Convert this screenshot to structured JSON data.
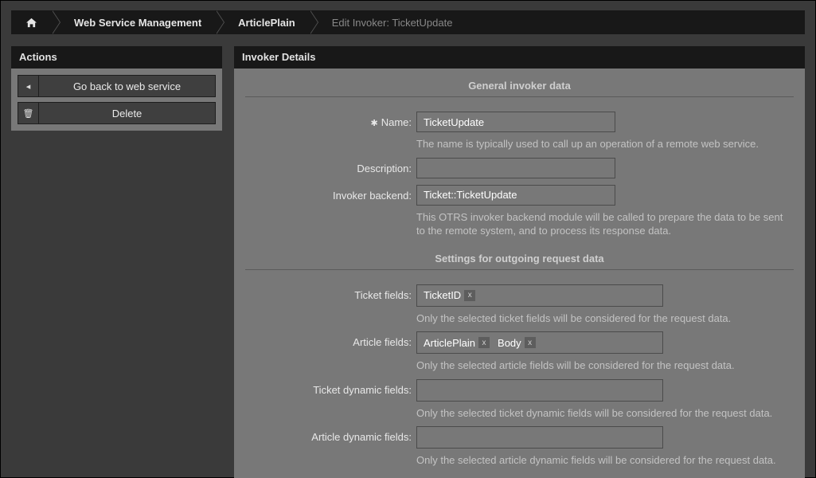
{
  "breadcrumb": {
    "items": [
      {
        "name": "home",
        "label": ""
      },
      {
        "name": "wsm",
        "label": "Web Service Management"
      },
      {
        "name": "ws",
        "label": "ArticlePlain"
      },
      {
        "name": "page",
        "label": "Edit Invoker: TicketUpdate"
      }
    ]
  },
  "sidebar": {
    "title": "Actions",
    "actions": [
      {
        "name": "back",
        "icon": "◂",
        "label": "Go back to web service"
      },
      {
        "name": "delete",
        "icon": "🗑",
        "label": "Delete"
      }
    ]
  },
  "main": {
    "title": "Invoker Details",
    "sections": {
      "general": {
        "heading": "General invoker data",
        "name": {
          "label": "Name:",
          "value": "TicketUpdate",
          "help": "The name is typically used to call up an operation of a remote web service."
        },
        "description": {
          "label": "Description:",
          "value": ""
        },
        "backend": {
          "label": "Invoker backend:",
          "value": "Ticket::TicketUpdate",
          "help": "This OTRS invoker backend module will be called to prepare the data to be sent to the remote system, and to process its response data."
        }
      },
      "outgoing": {
        "heading": "Settings for outgoing request data",
        "ticket_fields": {
          "label": "Ticket fields:",
          "tags": [
            "TicketID"
          ],
          "help": "Only the selected ticket fields will be considered for the request data."
        },
        "article_fields": {
          "label": "Article fields:",
          "tags": [
            "ArticlePlain",
            "Body"
          ],
          "help": "Only the selected article fields will be considered for the request data."
        },
        "ticket_dyn": {
          "label": "Ticket dynamic fields:",
          "tags": [],
          "help": "Only the selected ticket dynamic fields will be considered for the request data."
        },
        "article_dyn": {
          "label": "Article dynamic fields:",
          "tags": [],
          "help": "Only the selected article dynamic fields will be considered for the request data."
        }
      }
    }
  }
}
